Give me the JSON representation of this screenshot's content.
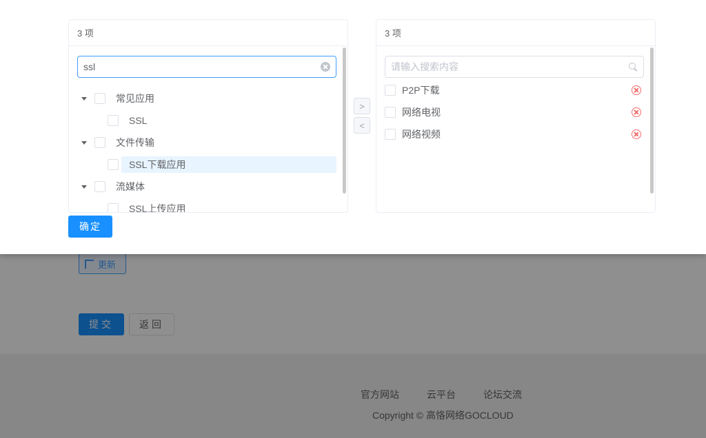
{
  "left_panel": {
    "header": "3 项",
    "search_value": "ssl",
    "tree": [
      {
        "label": "常见应用",
        "level": 1,
        "expanded": true
      },
      {
        "label": "SSL",
        "level": 2
      },
      {
        "label": "文件传输",
        "level": 1,
        "expanded": true
      },
      {
        "label": "SSL下载应用",
        "level": 2,
        "highlighted": true
      },
      {
        "label": "流媒体",
        "level": 1,
        "expanded": true
      },
      {
        "label": "SSL上传应用",
        "level": 2
      }
    ]
  },
  "right_panel": {
    "header": "3 项",
    "search_placeholder": "请输入搜索内容",
    "items": [
      {
        "label": "P2P下载"
      },
      {
        "label": "网络电视"
      },
      {
        "label": "网络视频"
      }
    ]
  },
  "transfer": {
    "to_right": ">",
    "to_left": "<"
  },
  "dialog": {
    "confirm_label": "确定"
  },
  "background": {
    "update_label": "更新",
    "submit_label": "提交",
    "back_label": "返回",
    "footer_links": [
      "官方网站",
      "云平台",
      "论坛交流"
    ],
    "copyright": "Copyright © 高恪网络GOCLOUD"
  },
  "colors": {
    "primary": "#1890ff",
    "remove": "#f56c6c",
    "highlight": "#e8f4ff"
  }
}
